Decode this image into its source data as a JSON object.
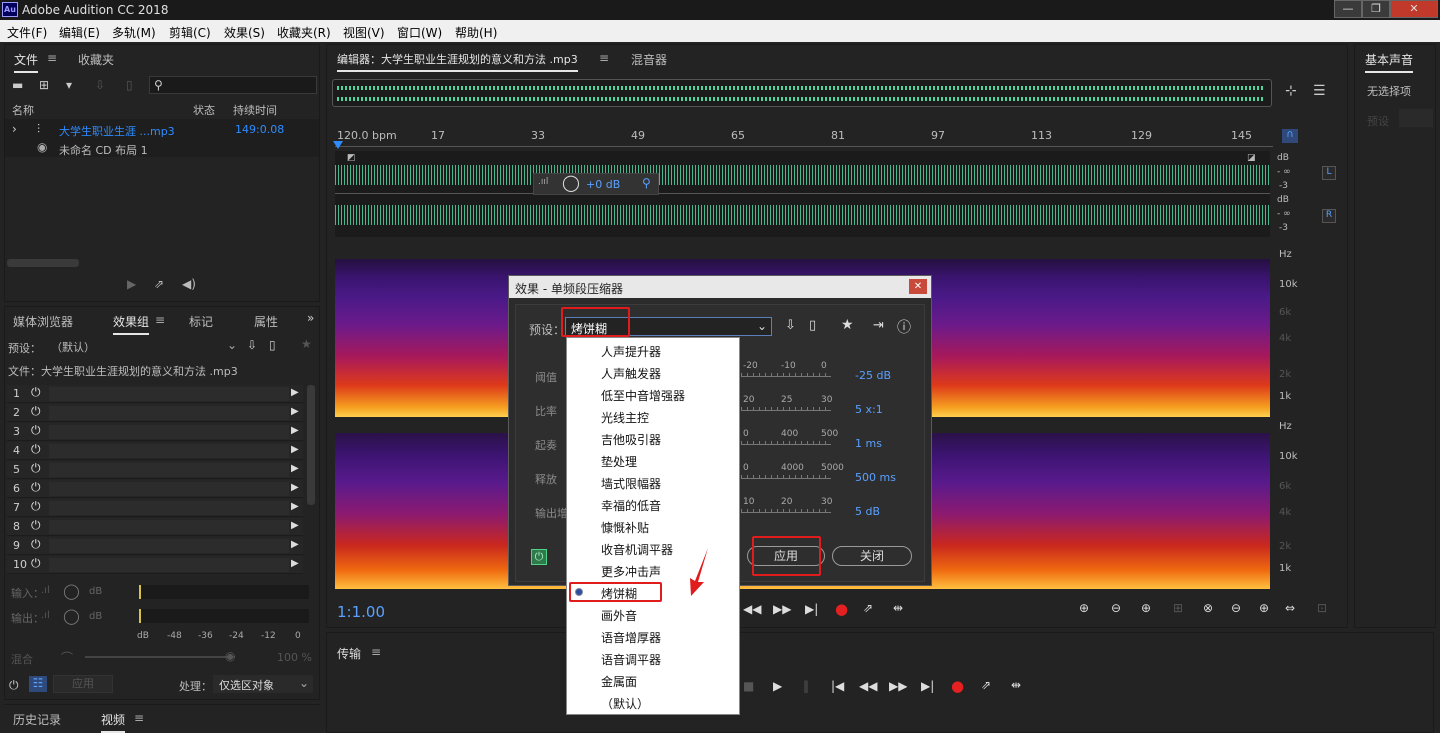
{
  "app": {
    "title": "Adobe Audition CC 2018",
    "logo": "Au"
  },
  "window_controls": [
    "minimize-icon",
    "restore-icon",
    "close-icon"
  ],
  "menu": [
    "文件(F)",
    "编辑(E)",
    "多轨(M)",
    "剪辑(C)",
    "效果(S)",
    "收藏夹(R)",
    "视图(V)",
    "窗口(W)",
    "帮助(H)"
  ],
  "files_panel": {
    "tabs": [
      "文件",
      "收藏夹"
    ],
    "columns": {
      "name": "名称",
      "status": "状态",
      "duration": "持续时间"
    },
    "rows": [
      {
        "name": "大学生职业生涯 ...mp3",
        "duration": "149:0.08"
      },
      {
        "name": "未命名 CD 布局 1",
        "duration": ""
      }
    ]
  },
  "effects_panel": {
    "tabs": [
      "媒体浏览器",
      "效果组",
      "标记",
      "属性"
    ],
    "preset_label": "预设：",
    "preset_value": "（默认）",
    "file_line": "文件：大学生职业生涯规划的意义和方法 .mp3",
    "slots": [
      "1",
      "2",
      "3",
      "4",
      "5",
      "6",
      "7",
      "8",
      "9",
      "10"
    ],
    "meter_ticks": [
      "dB",
      "-48",
      "-36",
      "-24",
      "-12",
      "0"
    ],
    "input_label": "输入：",
    "output_label": "输出：",
    "db_unit": "dB",
    "mix_label": "混合",
    "mix_value": "100 %",
    "apply_label": "应用",
    "process_label": "处理：",
    "process_value": "仅选区对象"
  },
  "bottom_left_tabs": [
    "历史记录",
    "视频"
  ],
  "editor": {
    "title": "编辑器：大学生职业生涯规划的意义和方法 .mp3",
    "mixer_tab": "混音器",
    "ruler": [
      "120.0 bpm",
      "17",
      "33",
      "49",
      "65",
      "81",
      "97",
      "113",
      "129",
      "145"
    ],
    "hud_gain": "+0 dB",
    "channels": [
      "L",
      "R"
    ],
    "db_scale": [
      "dB",
      "- ∞",
      "-3"
    ],
    "hz_scale_top": [
      "Hz",
      "10k",
      "6k",
      "4k",
      "2k",
      "1k"
    ],
    "hz_scale_bottom": [
      "Hz",
      "10k",
      "6k",
      "4k",
      "2k",
      "1k"
    ],
    "time_display": "1:1.00"
  },
  "transport": {
    "title": "传输"
  },
  "right_panel": {
    "title": "基本声音",
    "subtitle": "无选择项",
    "dim_label": "预设"
  },
  "dialog": {
    "title": "效果 - 单频段压缩器",
    "preset_label": "预设：",
    "preset_value": "烤饼糊",
    "params": [
      {
        "label": "阈值",
        "value": "-25 dB",
        "ticks": [
          "-20",
          "-10",
          "0"
        ]
      },
      {
        "label": "比率",
        "value": "5 x:1",
        "ticks": [
          "20",
          "25",
          "30"
        ]
      },
      {
        "label": "起奏",
        "value": "1 ms",
        "ticks": [
          "0",
          "400",
          "500"
        ]
      },
      {
        "label": "释放",
        "value": "500 ms",
        "ticks": [
          "0",
          "4000",
          "5000"
        ]
      },
      {
        "label": "输出增益",
        "value": "5 dB",
        "ticks": [
          "10",
          "20",
          "30"
        ]
      }
    ],
    "apply": "应用",
    "close": "关闭"
  },
  "preset_dropdown": {
    "items": [
      "人声提升器",
      "人声触发器",
      "低至中音增强器",
      "光线主控",
      "吉他吸引器",
      "垫处理",
      "墙式限幅器",
      "幸福的低音",
      "慷慨补贴",
      "收音机调平器",
      "更多冲击声",
      "烤饼糊",
      "画外音",
      "语音增厚器",
      "语音调平器",
      "金属面",
      "（默认）"
    ],
    "selected": "烤饼糊"
  },
  "colors": {
    "accent": "#2f8cff",
    "waveform": "#4fd4a0",
    "highlight": "#e01c1c",
    "record": "#e52020"
  }
}
